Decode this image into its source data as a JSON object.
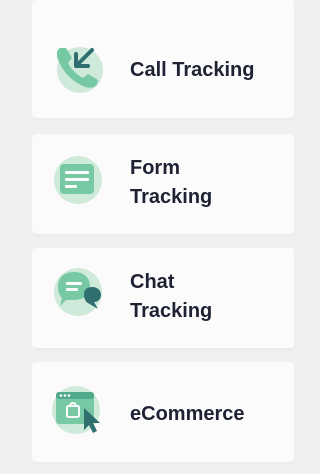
{
  "colors": {
    "accent": "#77c9a3",
    "accent_light": "#cfe9da",
    "accent_dark": "#2f6f70",
    "text": "#1e2233",
    "card_bg": "#fbfbfc",
    "page_bg": "#eef0f2"
  },
  "items": [
    {
      "icon": "phone-arrow-icon",
      "label_lines": [
        "Call Tracking"
      ]
    },
    {
      "icon": "form-icon",
      "label_lines": [
        "Form",
        "Tracking"
      ]
    },
    {
      "icon": "chat-bubbles-icon",
      "label_lines": [
        "Chat",
        "Tracking"
      ]
    },
    {
      "icon": "browser-cart-cursor-icon",
      "label_lines": [
        "eCommerce"
      ]
    }
  ]
}
